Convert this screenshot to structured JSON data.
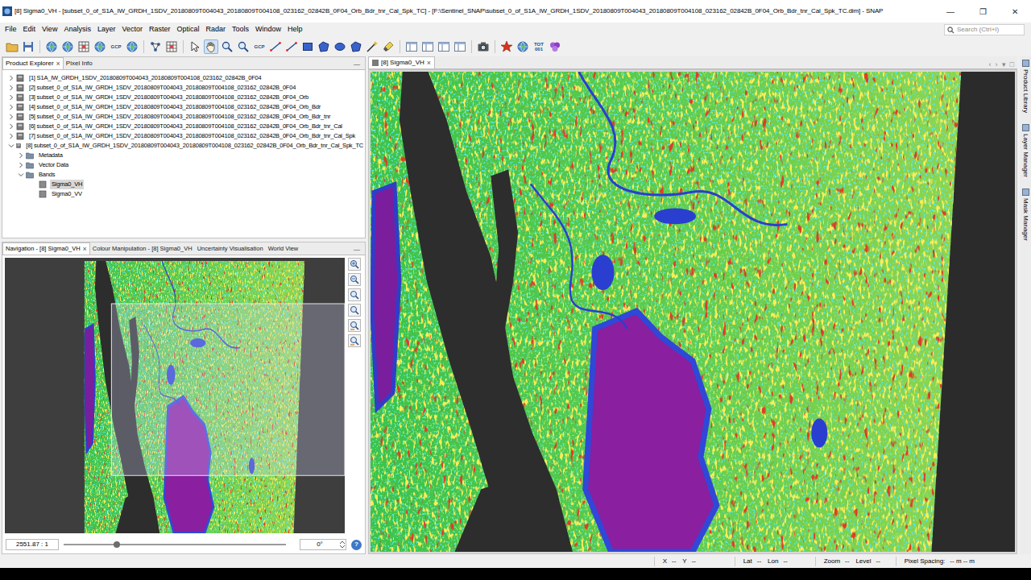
{
  "window": {
    "title": "[8] Sigma0_VH - [subset_0_of_S1A_IW_GRDH_1SDV_20180809T004043_20180809T004108_023162_02842B_0F04_Orb_Bdr_tnr_Cal_Spk_TC] - [F:\\Sentinel_SNAP\\subset_0_of_S1A_IW_GRDH_1SDV_20180809T004043_20180809T004108_023162_02842B_0F04_Orb_Bdr_tnr_Cal_Spk_TC.dim] - SNAP",
    "controls": [
      "—",
      "❐",
      "✕"
    ]
  },
  "menu": [
    "File",
    "Edit",
    "View",
    "Analysis",
    "Layer",
    "Vector",
    "Raster",
    "Optical",
    "Radar",
    "Tools",
    "Window",
    "Help"
  ],
  "search": {
    "placeholder": "Search (Ctrl+I)"
  },
  "toolbar": [
    {
      "kind": "folder",
      "label": "",
      "selected": false
    },
    {
      "kind": "disk",
      "label": "",
      "selected": false
    },
    {
      "kind": "separator",
      "label": "",
      "selected": false
    },
    {
      "kind": "globe",
      "label": "",
      "selected": false
    },
    {
      "kind": "globe",
      "label": "",
      "selected": false
    },
    {
      "kind": "grid",
      "label": "",
      "selected": false
    },
    {
      "kind": "globe",
      "label": "",
      "selected": false
    },
    {
      "kind": "text",
      "label": "GCP",
      "selected": false
    },
    {
      "kind": "globe",
      "label": "",
      "selected": false
    },
    {
      "kind": "separator",
      "label": "",
      "selected": false
    },
    {
      "kind": "network",
      "label": "",
      "selected": false
    },
    {
      "kind": "grid",
      "label": "",
      "selected": false
    },
    {
      "kind": "separator",
      "label": "",
      "selected": false
    },
    {
      "kind": "arrow",
      "label": "",
      "selected": false
    },
    {
      "kind": "hand",
      "label": "",
      "selected": true
    },
    {
      "kind": "zoom",
      "label": "",
      "selected": false
    },
    {
      "kind": "zoom",
      "label": "",
      "selected": false
    },
    {
      "kind": "text",
      "label": "GCP",
      "selected": false
    },
    {
      "kind": "line",
      "label": "",
      "selected": false
    },
    {
      "kind": "line",
      "label": "",
      "selected": false
    },
    {
      "kind": "rect",
      "label": "",
      "selected": false
    },
    {
      "kind": "polygon",
      "label": "",
      "selected": false
    },
    {
      "kind": "ellipse",
      "label": "",
      "selected": false
    },
    {
      "kind": "polygon",
      "label": "",
      "selected": false
    },
    {
      "kind": "wand",
      "label": "",
      "selected": false
    },
    {
      "kind": "brush",
      "label": "",
      "selected": false
    },
    {
      "kind": "separator",
      "label": "",
      "selected": false
    },
    {
      "kind": "panel",
      "label": "",
      "selected": false
    },
    {
      "kind": "panel",
      "label": "",
      "selected": false
    },
    {
      "kind": "panel",
      "label": "",
      "selected": false
    },
    {
      "kind": "panel",
      "label": "",
      "selected": false
    },
    {
      "kind": "separator",
      "label": "",
      "selected": false
    },
    {
      "kind": "camera",
      "label": "",
      "selected": false
    },
    {
      "kind": "separator",
      "label": "",
      "selected": false
    },
    {
      "kind": "star",
      "label": "",
      "selected": false
    },
    {
      "kind": "globe",
      "label": "",
      "selected": false
    },
    {
      "kind": "text",
      "label": "TOT 001",
      "selected": false
    },
    {
      "kind": "flower",
      "label": "",
      "selected": false
    }
  ],
  "product_explorer": {
    "tabs": [
      {
        "label": "Product Explorer",
        "close": "×",
        "selected": true
      },
      {
        "label": "Pixel Info",
        "selected": false
      }
    ],
    "minimize": "—",
    "products": [
      {
        "label": "[1] S1A_IW_GRDH_1SDV_20180809T004043_20180809T004108_023162_02842B_0F04",
        "kind": "product",
        "expanded": false,
        "selected": false
      },
      {
        "label": "[2] subset_0_of_S1A_IW_GRDH_1SDV_20180809T004043_20180809T004108_023162_02842B_0F04",
        "kind": "product",
        "expanded": false,
        "selected": false
      },
      {
        "label": "[3] subset_0_of_S1A_IW_GRDH_1SDV_20180809T004043_20180809T004108_023162_02842B_0F04_Orb",
        "kind": "product",
        "expanded": false,
        "selected": false
      },
      {
        "label": "[4] subset_0_of_S1A_IW_GRDH_1SDV_20180809T004043_20180809T004108_023162_02842B_0F04_Orb_Bdr",
        "kind": "product",
        "expanded": false,
        "selected": false
      },
      {
        "label": "[5] subset_0_of_S1A_IW_GRDH_1SDV_20180809T004043_20180809T004108_023162_02842B_0F04_Orb_Bdr_tnr",
        "kind": "product",
        "expanded": false,
        "selected": false
      },
      {
        "label": "[6] subset_0_of_S1A_IW_GRDH_1SDV_20180809T004043_20180809T004108_023162_02842B_0F04_Orb_Bdr_tnr_Cal",
        "kind": "product",
        "expanded": false,
        "selected": false
      },
      {
        "label": "[7] subset_0_of_S1A_IW_GRDH_1SDV_20180809T004043_20180809T004108_023162_02842B_0F04_Orb_Bdr_tnr_Cal_Spk",
        "kind": "product",
        "expanded": false,
        "selected": false
      },
      {
        "label": "[8] subset_0_of_S1A_IW_GRDH_1SDV_20180809T004043_20180809T004108_023162_02842B_0F04_Orb_Bdr_tnr_Cal_Spk_TC",
        "kind": "product",
        "expanded": true,
        "selected": false,
        "children": [
          {
            "label": "Metadata",
            "kind": "folder",
            "expanded": false,
            "selected": false
          },
          {
            "label": "Vector Data",
            "kind": "folder",
            "expanded": false,
            "selected": false
          },
          {
            "label": "Bands",
            "kind": "folder",
            "expanded": true,
            "selected": false,
            "children": [
              {
                "label": "Sigma0_VH",
                "kind": "band",
                "selected": true
              },
              {
                "label": "Sigma0_VV",
                "kind": "band",
                "selected": false
              }
            ]
          }
        ]
      }
    ]
  },
  "tool_panel": {
    "tabs": [
      {
        "label": "Navigation - [8] Sigma0_VH",
        "close": "×",
        "selected": true
      },
      {
        "label": "Colour Manipulation - [8] Sigma0_VH",
        "selected": false
      },
      {
        "label": "Uncertainty Visualisation",
        "selected": false
      },
      {
        "label": "World View",
        "selected": false
      }
    ],
    "minimize": "—",
    "zoom_field": "2551.87 : 1",
    "slider": {
      "level": 0.24
    },
    "rotation": "0°",
    "help": "?"
  },
  "image_view": {
    "tabs": [
      {
        "label": "[8] Sigma0_VH",
        "close": "×",
        "selected": true
      }
    ],
    "nav_arrows": [
      "‹",
      "›",
      "▾",
      "□"
    ]
  },
  "side_panels": [
    "Product Library",
    "Layer Manager",
    "Mask Manager"
  ],
  "status_bar": [
    {
      "fields": [
        {
          "label": "X",
          "value": "--"
        },
        {
          "label": "Y",
          "value": "--"
        }
      ]
    },
    {
      "fields": [
        {
          "label": "Lat",
          "value": "--"
        },
        {
          "label": "Lon",
          "value": "--"
        }
      ]
    },
    {
      "fields": [
        {
          "label": "Zoom",
          "value": "--"
        },
        {
          "label": "Level",
          "value": "--"
        }
      ]
    },
    {
      "fields": [
        {
          "label": "Pixel Spacing:",
          "value": "-- m -- m"
        }
      ]
    }
  ]
}
